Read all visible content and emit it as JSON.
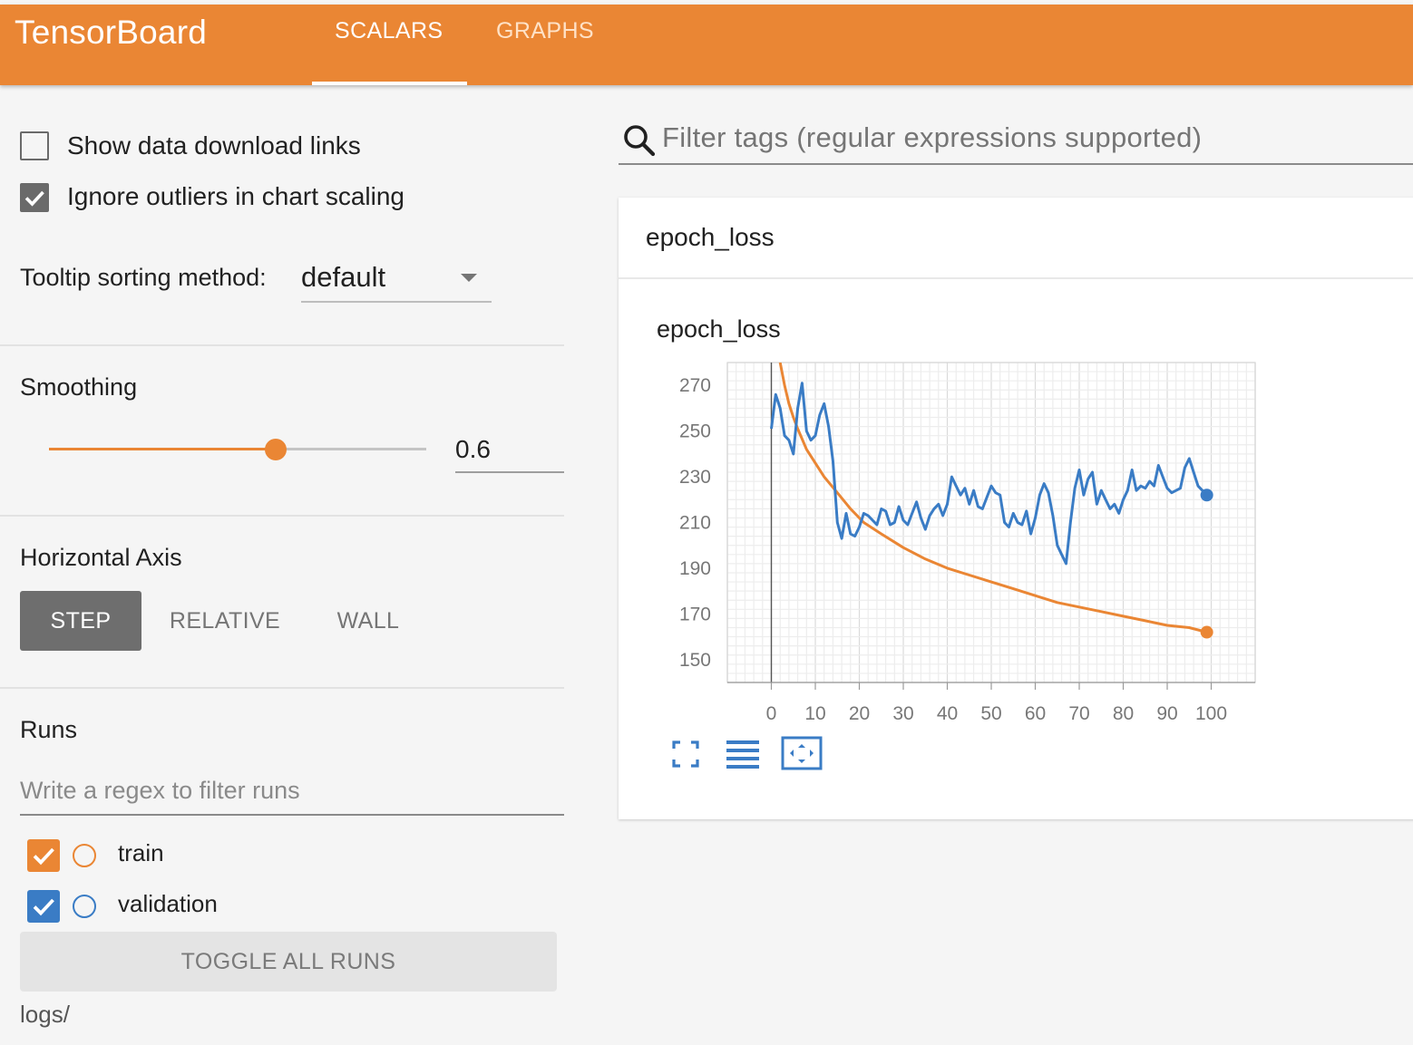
{
  "app": {
    "title": "TensorBoard",
    "tabs": [
      {
        "label": "SCALARS",
        "active": true
      },
      {
        "label": "GRAPHS",
        "active": false
      }
    ],
    "accent_color": "#ea8634"
  },
  "sidebar": {
    "show_download_links": {
      "label": "Show data download links",
      "checked": false
    },
    "ignore_outliers": {
      "label": "Ignore outliers in chart scaling",
      "checked": true
    },
    "tooltip_sorting": {
      "label": "Tooltip sorting method:",
      "value": "default"
    },
    "smoothing": {
      "title": "Smoothing",
      "value": "0.6",
      "fraction": 0.6
    },
    "horizontal_axis": {
      "title": "Horizontal Axis",
      "options": [
        "STEP",
        "RELATIVE",
        "WALL"
      ],
      "selected": "STEP"
    },
    "runs": {
      "title": "Runs",
      "filter_placeholder": "Write a regex to filter runs",
      "items": [
        {
          "name": "train",
          "checked": true,
          "color": "#ea8634"
        },
        {
          "name": "validation",
          "checked": true,
          "color": "#3a7cc5"
        }
      ],
      "toggle_label": "TOGGLE ALL RUNS",
      "logdir": "logs/"
    }
  },
  "main": {
    "filter_placeholder": "Filter tags (regular expressions supported)",
    "card": {
      "header": "epoch_loss",
      "chart_title": "epoch_loss",
      "tools": [
        "fullscreen-icon",
        "list-icon",
        "fit-domain-icon"
      ]
    }
  },
  "chart_data": {
    "type": "line",
    "title": "epoch_loss",
    "xlabel": "",
    "ylabel": "",
    "xlim": [
      -10,
      110
    ],
    "ylim": [
      140,
      280
    ],
    "xticks": [
      0,
      10,
      20,
      30,
      40,
      50,
      60,
      70,
      80,
      90,
      100
    ],
    "yticks": [
      150,
      170,
      190,
      210,
      230,
      250,
      270
    ],
    "grid": true,
    "series": [
      {
        "name": "train",
        "color": "#ea8634",
        "x": [
          2,
          3,
          4,
          5,
          6,
          8,
          10,
          12,
          15,
          18,
          21,
          25,
          30,
          35,
          40,
          45,
          50,
          55,
          60,
          65,
          70,
          75,
          80,
          85,
          90,
          95,
          99
        ],
        "values": [
          280,
          270,
          262,
          256,
          251,
          242,
          236,
          230,
          223,
          216,
          210,
          205,
          199,
          194,
          190,
          187,
          184,
          181,
          178,
          175,
          173,
          171,
          169,
          167,
          165,
          164,
          162
        ]
      },
      {
        "name": "validation",
        "color": "#3a7cc5",
        "x": [
          0,
          1,
          2,
          3,
          4,
          5,
          6,
          7,
          8,
          9,
          10,
          11,
          12,
          13,
          14,
          15,
          16,
          17,
          18,
          19,
          20,
          21,
          22,
          23,
          24,
          25,
          26,
          27,
          28,
          29,
          30,
          31,
          32,
          33,
          34,
          35,
          36,
          37,
          38,
          39,
          40,
          41,
          42,
          43,
          44,
          45,
          46,
          47,
          48,
          49,
          50,
          51,
          52,
          53,
          54,
          55,
          56,
          57,
          58,
          59,
          60,
          61,
          62,
          63,
          64,
          65,
          66,
          67,
          68,
          69,
          70,
          71,
          72,
          73,
          74,
          75,
          76,
          77,
          78,
          79,
          80,
          81,
          82,
          83,
          84,
          85,
          86,
          87,
          88,
          89,
          90,
          91,
          92,
          93,
          94,
          95,
          96,
          97,
          98,
          99
        ],
        "values": [
          251,
          266,
          260,
          248,
          246,
          240,
          260,
          271,
          250,
          246,
          248,
          257,
          262,
          252,
          237,
          210,
          203,
          214,
          205,
          204,
          208,
          214,
          213,
          211,
          209,
          216,
          215,
          209,
          210,
          217,
          211,
          209,
          214,
          219,
          212,
          207,
          213,
          216,
          218,
          213,
          218,
          230,
          226,
          222,
          225,
          218,
          224,
          217,
          216,
          221,
          226,
          223,
          222,
          210,
          208,
          214,
          210,
          209,
          215,
          205,
          212,
          222,
          227,
          223,
          213,
          200,
          196,
          192,
          210,
          225,
          233,
          222,
          229,
          232,
          218,
          224,
          220,
          216,
          218,
          214,
          220,
          224,
          233,
          224,
          226,
          225,
          228,
          226,
          235,
          230,
          225,
          223,
          224,
          225,
          234,
          238,
          232,
          226,
          224,
          222
        ]
      }
    ]
  }
}
